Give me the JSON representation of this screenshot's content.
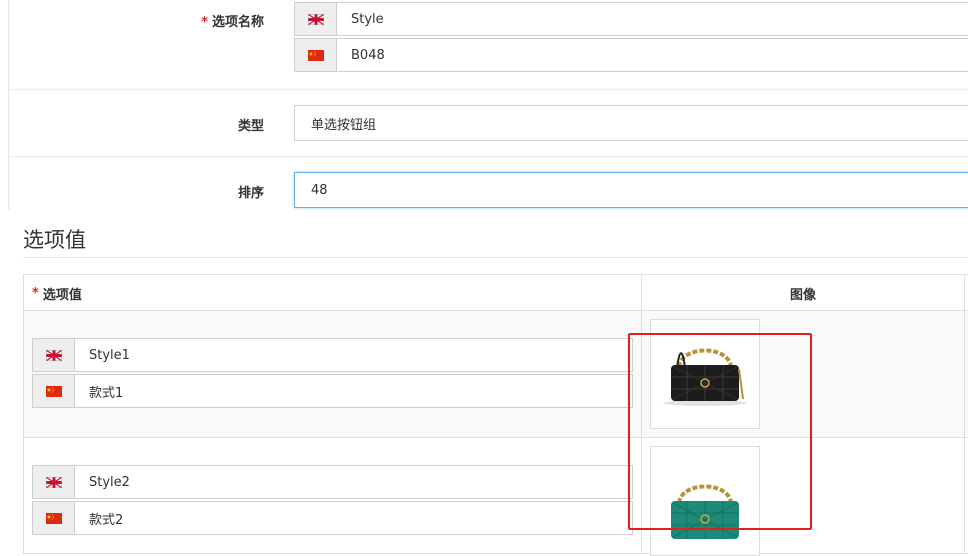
{
  "form": {
    "option_name": {
      "label": "选项名称",
      "required_mark": "*",
      "languages": [
        {
          "lang": "en",
          "flag_icon": "uk-flag-icon",
          "value": "Style"
        },
        {
          "lang": "zh",
          "flag_icon": "china-flag-icon",
          "value": "B048"
        }
      ]
    },
    "type": {
      "label": "类型",
      "value": "单选按钮组"
    },
    "sort": {
      "label": "排序",
      "value": "48"
    }
  },
  "option_values": {
    "section_title": "选项值",
    "columns": [
      {
        "label": "选项值",
        "required_mark": "*"
      },
      {
        "label": "图像"
      }
    ],
    "rows": [
      {
        "names": [
          {
            "lang": "en",
            "flag_icon": "uk-flag-icon",
            "value": "Style1"
          },
          {
            "lang": "zh",
            "flag_icon": "china-flag-icon",
            "value": "款式1"
          }
        ],
        "image": "black-chain-handbag-thumbnail"
      },
      {
        "names": [
          {
            "lang": "en",
            "flag_icon": "uk-flag-icon",
            "value": "Style2"
          },
          {
            "lang": "zh",
            "flag_icon": "china-flag-icon",
            "value": "款式2"
          }
        ],
        "image": "green-chain-handbag-thumbnail"
      }
    ]
  },
  "colors": {
    "required": "#e0261d",
    "highlight_box": "#e02020",
    "focus_border": "#66afe9"
  }
}
